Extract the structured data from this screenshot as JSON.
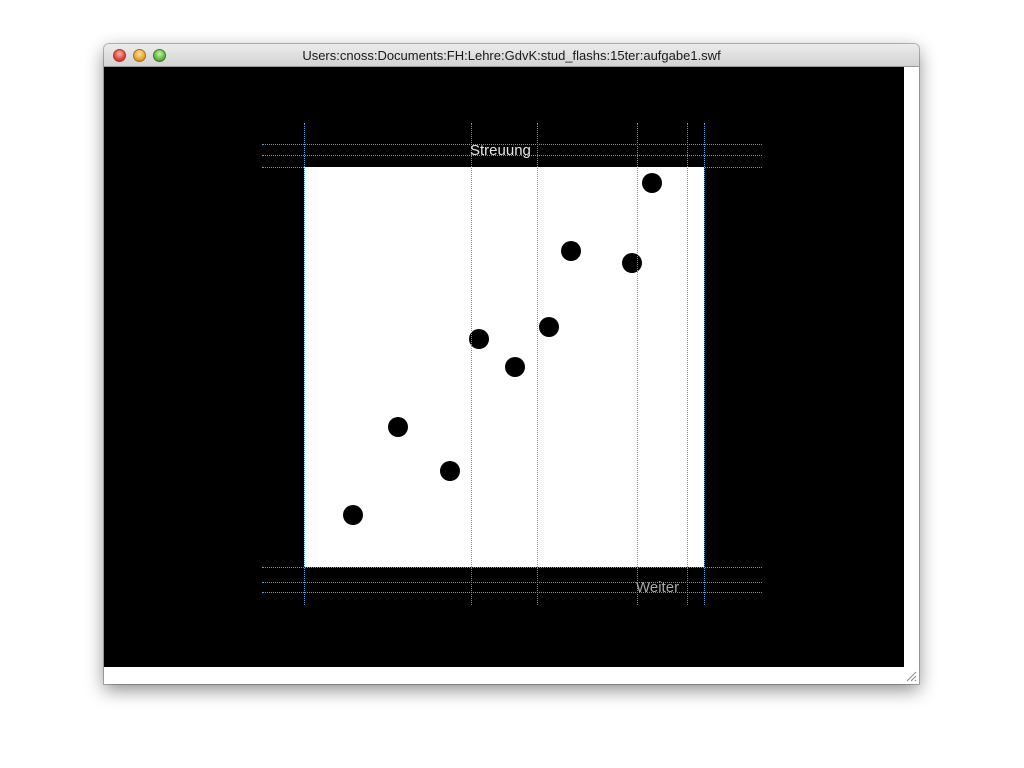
{
  "window": {
    "title": "Users:cnoss:Documents:FH:Lehre:GdvK:stud_flashs:15ter:aufgabe1.swf"
  },
  "stage": {
    "title_label": "Streuung",
    "next_label": "Weiter",
    "colors": {
      "background": "#000000",
      "plot": "#ffffff",
      "dot": "#000000",
      "guide": "#4aa3d6"
    }
  },
  "chart_data": {
    "type": "scatter",
    "points": [
      {
        "x": 49,
        "y": 13
      },
      {
        "x": 94,
        "y": 35
      },
      {
        "x": 146,
        "y": 24
      },
      {
        "x": 175,
        "y": 57
      },
      {
        "x": 211,
        "y": 50
      },
      {
        "x": 245,
        "y": 60
      },
      {
        "x": 267,
        "y": 79
      },
      {
        "x": 328,
        "y": 76
      },
      {
        "x": 348,
        "y": 96
      }
    ],
    "xlim": [
      0,
      400
    ],
    "ylim": [
      0,
      100
    ],
    "grid": false
  }
}
